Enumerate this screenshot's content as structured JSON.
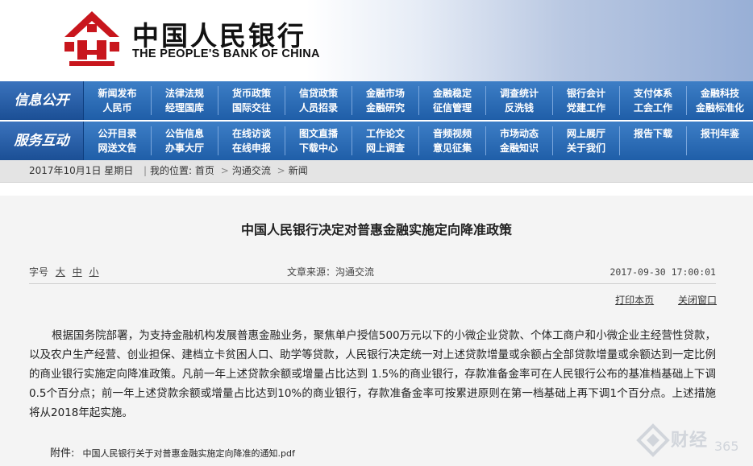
{
  "header": {
    "bank_name_cn": "中国人民银行",
    "bank_name_en": "THE PEOPLE'S BANK OF CHINA",
    "logo_icon": "pboc-emblem-icon",
    "brand_color": "#c8161d"
  },
  "nav": {
    "info": {
      "label": "信息公开",
      "items": [
        "新闻发布",
        "法律法规",
        "货币政策",
        "信贷政策",
        "金融市场",
        "金融稳定",
        "调查统计",
        "银行会计",
        "支付体系",
        "金融科技",
        "人民币",
        "经理国库",
        "国际交往",
        "人员招录",
        "金融研究",
        "征信管理",
        "反洗钱",
        "党建工作",
        "工会工作",
        "金融标准化"
      ]
    },
    "service": {
      "label": "服务互动",
      "items": [
        "公开目录",
        "公告信息",
        "在线访谈",
        "图文直播",
        "工作论文",
        "音频视频",
        "市场动态",
        "网上展厅",
        "报告下载",
        "报刊年鉴",
        "网送文告",
        "办事大厅",
        "在线申报",
        "下载中心",
        "网上调查",
        "意见征集",
        "金融知识",
        "关于我们",
        "",
        ""
      ]
    }
  },
  "breadcrumb": {
    "date": "2017年10月1日  星期日",
    "location_label": "我的位置:",
    "items": [
      "首页",
      "沟通交流",
      "新闻"
    ]
  },
  "article": {
    "title": "中国人民银行决定对普惠金融实施定向降准政策",
    "font_size_label": "字号",
    "font_sizes": [
      "大",
      "中",
      "小"
    ],
    "source": "文章来源：沟通交流",
    "timestamp": "2017-09-30  17:00:01",
    "print_link": "打印本页",
    "close_link": "关闭窗口",
    "body": "根据国务院部署，为支持金融机构发展普惠金融业务，聚焦单户授信500万元以下的小微企业贷款、个体工商户和小微企业主经营性贷款，以及农户生产经营、创业担保、建档立卡贫困人口、助学等贷款，人民银行决定统一对上述贷款增量或余额占全部贷款增量或余额达到一定比例的商业银行实施定向降准政策。凡前一年上述贷款余额或增量占比达到 1.5%的商业银行，存款准备金率可在人民银行公布的基准档基础上下调0.5个百分点；前一年上述贷款余额或增量占比达到10%的商业银行，存款准备金率可按累进原则在第一档基础上再下调1个百分点。上述措施将从2018年起实施。",
    "attachment_label": "附件:",
    "attachment_file": "中国人民银行关于对普惠金融实施定向降准的通知.pdf"
  },
  "watermark": {
    "text": "财经",
    "number": "365",
    "icon": "caijing365-logo-icon"
  }
}
